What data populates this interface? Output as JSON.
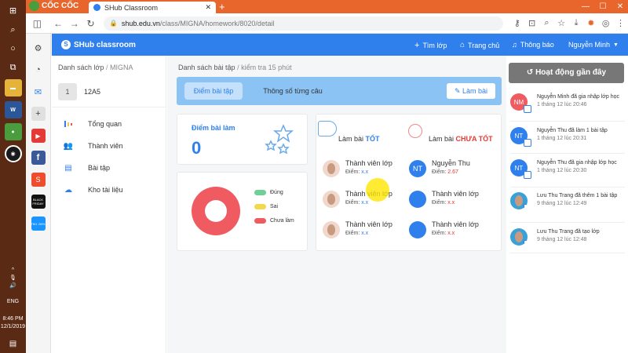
{
  "browser": {
    "brand": "CỐC CỐC",
    "tab_title": "SHub Classroom",
    "url_host": "shub.edu.vn",
    "url_path": "/class/MIGNA/homework/8020/detail"
  },
  "taskbar": {
    "lang": "ENG",
    "time": "8:46 PM",
    "date": "12/1/2019",
    "tiki_label": "TIKI -90%",
    "black_label": "BLACK FRIDAY"
  },
  "header": {
    "logo": "SHub classroom",
    "join_label": "Tìm lớp",
    "home_label": "Trang chủ",
    "notify_label": "Thông báo",
    "user_name": "Nguyễn Minh"
  },
  "left": {
    "breadcrumb_root": "Danh sách lớp",
    "breadcrumb_current": "MIGNA",
    "class_num": "1",
    "class_name": "12A5",
    "menu": [
      {
        "label": "Tổng quan"
      },
      {
        "label": "Thành viên"
      },
      {
        "label": "Bài tập"
      },
      {
        "label": "Kho tài liệu"
      }
    ]
  },
  "main": {
    "breadcrumb_root": "Danh sách bài tập",
    "breadcrumb_current": "kiểm tra 15 phút",
    "tab_scores": "Điểm bài tập",
    "tab_stats": "Thông số từng câu",
    "do_button": "Làm bài",
    "score_label": "Điểm bài làm",
    "score_value": "0",
    "legend": [
      "Đúng",
      "Sai",
      "Chưa làm"
    ],
    "legend_colors": [
      "#6fcf97",
      "#f2d94e",
      "#ef5b60"
    ],
    "good_prefix": "Làm bài",
    "good_word": "TỐT",
    "bad_prefix": "Làm bài",
    "bad_word": "CHƯA TỐT",
    "score_prefix": "Điểm:",
    "good_students": [
      {
        "name": "Thành viên lớp",
        "score": "x.x"
      },
      {
        "name": "Thành viên lớp",
        "score": "x.x"
      },
      {
        "name": "Thành viên lớp",
        "score": "x.x"
      }
    ],
    "bad_students": [
      {
        "name": "Nguyễn Thu",
        "score": "2.67",
        "initials": "NT"
      },
      {
        "name": "Thành viên lớp",
        "score": "x.x"
      },
      {
        "name": "Thành viên lớp",
        "score": "x.x"
      }
    ]
  },
  "right": {
    "activity_button": "Hoạt động gần đây",
    "activities": [
      {
        "initials": "NM",
        "text": "Nguyễn Minh đã gia nhập lớp học",
        "time": "1 tháng 12 lúc 20:46"
      },
      {
        "initials": "NT",
        "text": "Nguyễn Thu đã làm 1 bài tập",
        "time": "1 tháng 12 lúc 20:31"
      },
      {
        "initials": "NT",
        "text": "Nguyễn Thu đã gia nhập lớp học",
        "time": "1 tháng 12 lúc 20:30"
      },
      {
        "initials": "",
        "text": "Lưu Thu Trang đã thêm 1 bài tập",
        "time": "9 tháng 12 lúc 12:49"
      },
      {
        "initials": "",
        "text": "Lưu Thu Trang đã tạo lớp",
        "time": "9 tháng 12 lúc 12:48"
      }
    ]
  }
}
